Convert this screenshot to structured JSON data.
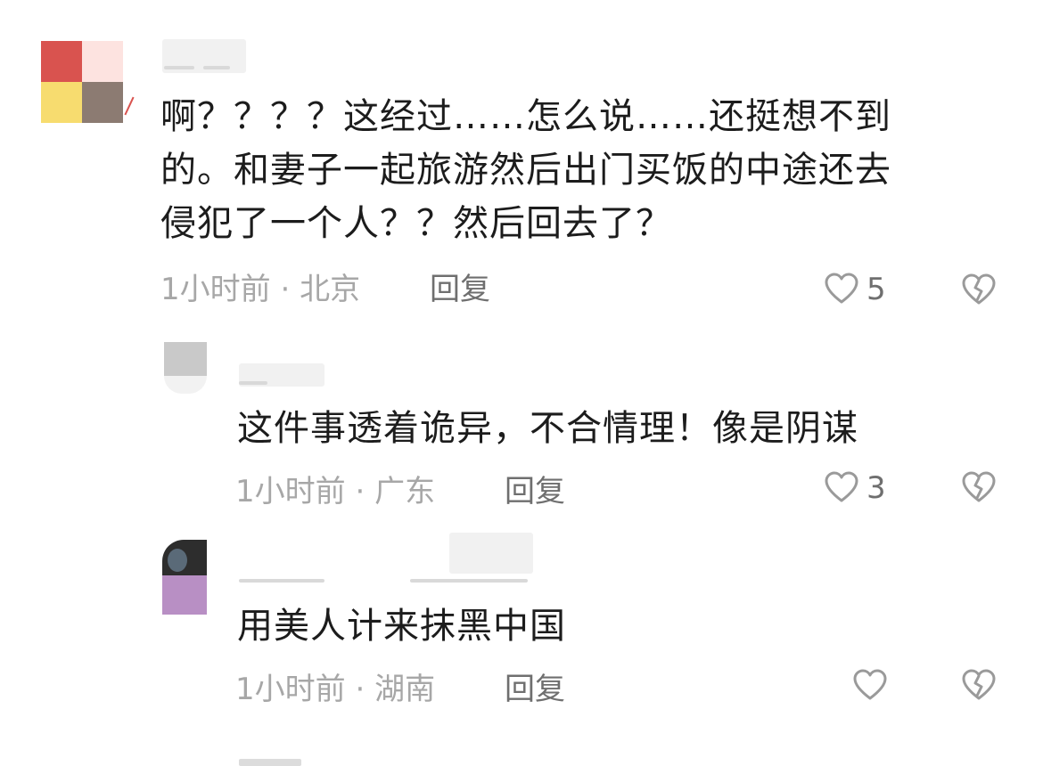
{
  "comments": [
    {
      "text_lines": [
        "啊？？？？这经过……怎么说……还挺想不到",
        "的。和妻子一起旅游然后出门买饭的中途还去",
        "侵犯了一个人？？然后回去了？"
      ],
      "time": "1小时前",
      "location": "北京",
      "reply_label": "回复",
      "likes": "5",
      "avatar_colors": [
        "#d9534f",
        "#fde3e0",
        "#f7dc6f",
        "#8c7b72"
      ]
    },
    {
      "text_lines": [
        "这件事透着诡异，不合情理！像是阴谋"
      ],
      "time": "1小时前",
      "location": "广东",
      "reply_label": "回复",
      "likes": "3"
    },
    {
      "text_lines": [
        "用美人计来抹黑中国"
      ],
      "time": "1小时前",
      "location": "湖南",
      "reply_label": "回复",
      "likes": ""
    }
  ],
  "meta_separator": "·",
  "colors": {
    "text": "#1c1c1c",
    "meta": "#a7a7a7",
    "reply": "#6f6f6f",
    "icon": "#9a9a9a"
  }
}
